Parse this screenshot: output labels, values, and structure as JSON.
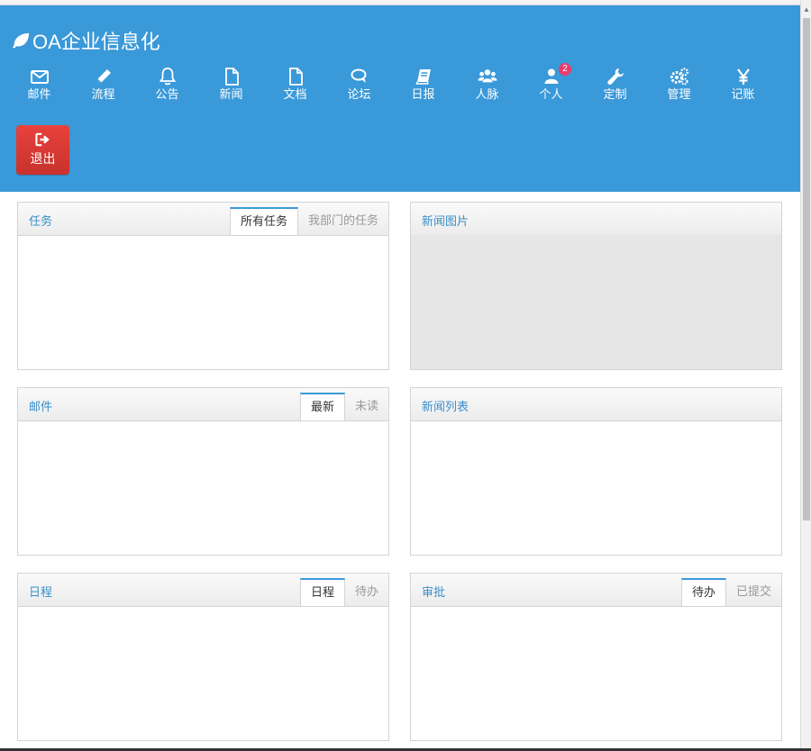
{
  "brand": {
    "title": "OA企业信息化"
  },
  "nav": [
    {
      "label": "邮件",
      "icon": "envelope-icon"
    },
    {
      "label": "流程",
      "icon": "pencil-icon"
    },
    {
      "label": "公告",
      "icon": "bell-icon"
    },
    {
      "label": "新闻",
      "icon": "file-icon"
    },
    {
      "label": "文档",
      "icon": "file-icon"
    },
    {
      "label": "论坛",
      "icon": "chat-icon"
    },
    {
      "label": "日报",
      "icon": "book-icon"
    },
    {
      "label": "人脉",
      "icon": "users-icon"
    },
    {
      "label": "个人",
      "icon": "user-icon",
      "badge": "2"
    },
    {
      "label": "定制",
      "icon": "wrench-icon"
    },
    {
      "label": "管理",
      "icon": "gears-icon"
    },
    {
      "label": "记账",
      "icon": "yen-icon"
    }
  ],
  "logout": {
    "label": "退出"
  },
  "panels": {
    "tasks": {
      "title": "任务",
      "tabs": [
        "所有任务",
        "我部门的任务"
      ]
    },
    "news_images": {
      "title": "新闻图片"
    },
    "mail": {
      "title": "邮件",
      "tabs": [
        "最新",
        "未读"
      ]
    },
    "news_list": {
      "title": "新闻列表"
    },
    "schedule": {
      "title": "日程",
      "tabs": [
        "日程",
        "待办"
      ]
    },
    "approval": {
      "title": "审批",
      "tabs": [
        "待办",
        "已提交"
      ]
    }
  },
  "colors": {
    "header_bg": "#3a99d9",
    "logout_bg": "#d9372f",
    "badge_bg": "#e83e6c",
    "accent": "#3a8fc8"
  }
}
